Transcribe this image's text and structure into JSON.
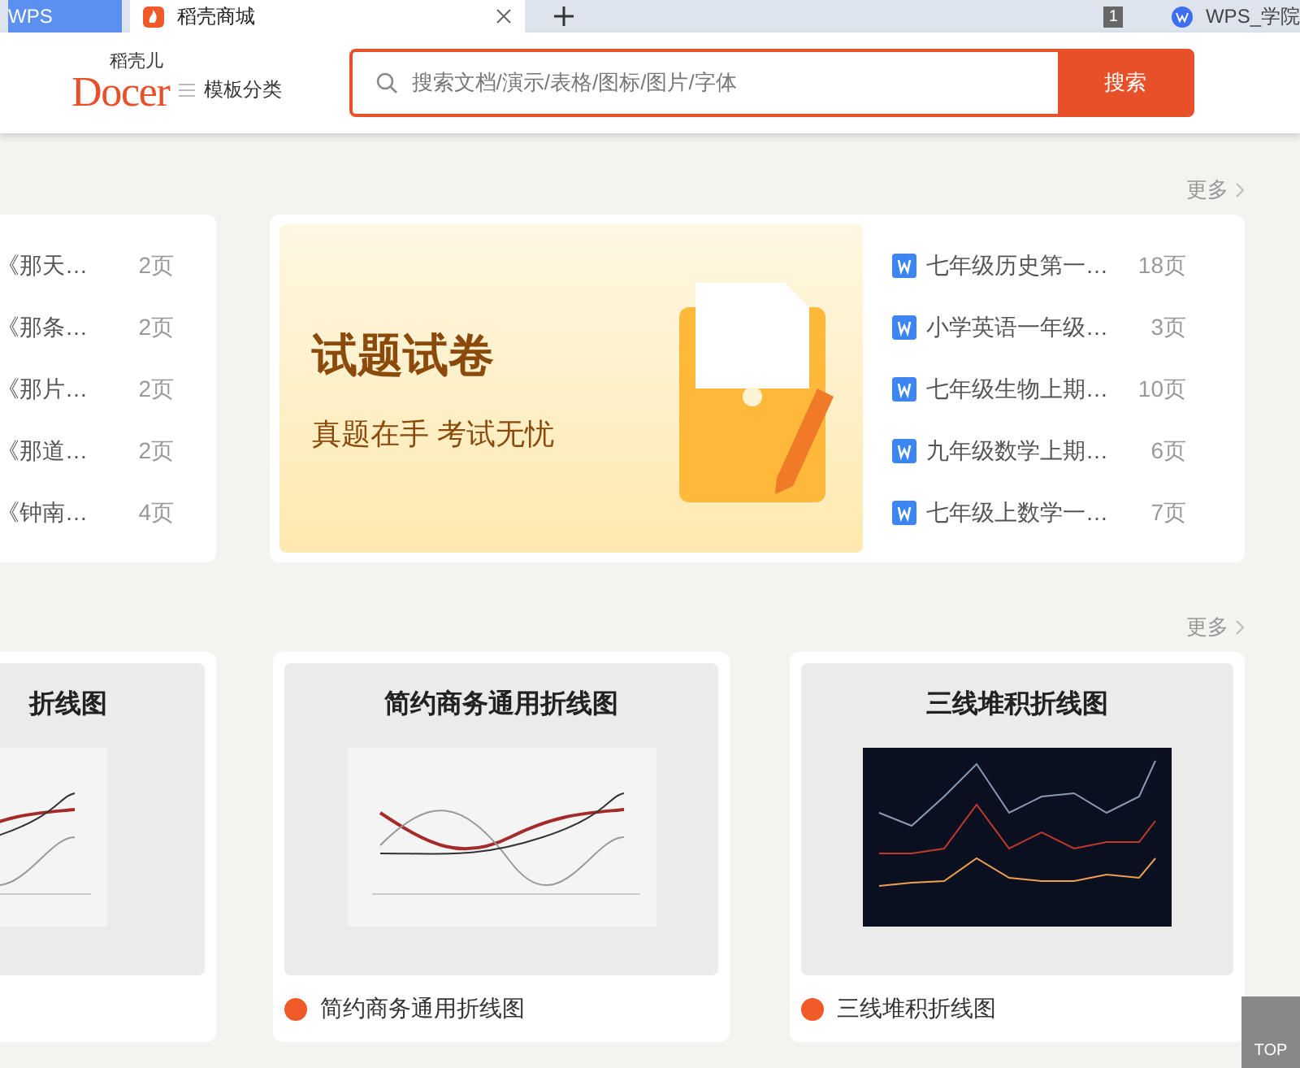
{
  "browser_tabs": [
    {
      "label": "WPS",
      "selected": false
    },
    {
      "label": "稻壳商城",
      "selected": true
    }
  ],
  "tab_counter": "1",
  "bookmark": "WPS_学院",
  "header": {
    "logo_top": "稻壳儿",
    "logo_word": "Docer",
    "category_menu": "模板分类",
    "search_placeholder": "搜索文档/演示/表格/图标/图片/字体",
    "search_button": "搜索"
  },
  "section_1": {
    "more": "更多",
    "left_list": [
      {
        "title": "《那天…",
        "pages": "2页"
      },
      {
        "title": "《那条…",
        "pages": "2页"
      },
      {
        "title": "《那片…",
        "pages": "2页"
      },
      {
        "title": "《那道…",
        "pages": "2页"
      },
      {
        "title": "《钟南…",
        "pages": "4页"
      }
    ],
    "banner": {
      "title": "试题试卷",
      "subtitle": "真题在手 考试无忧"
    },
    "right_list": [
      {
        "title": "七年级历史第一…",
        "pages": "18页"
      },
      {
        "title": "小学英语一年级…",
        "pages": "3页"
      },
      {
        "title": "七年级生物上期…",
        "pages": "10页"
      },
      {
        "title": "九年级数学上期…",
        "pages": "6页"
      },
      {
        "title": "七年级上数学一…",
        "pages": "7页"
      }
    ]
  },
  "section_2": {
    "more": "更多",
    "templates": [
      {
        "kind": "light",
        "thumb_title": "折线图"
      },
      {
        "kind": "light",
        "thumb_title": "简约商务通用折线图",
        "caption": "简约商务通用折线图"
      },
      {
        "kind": "dark",
        "thumb_title": "三线堆积折线图",
        "caption": "三线堆积折线图"
      }
    ]
  },
  "back_to_top": "TOP"
}
